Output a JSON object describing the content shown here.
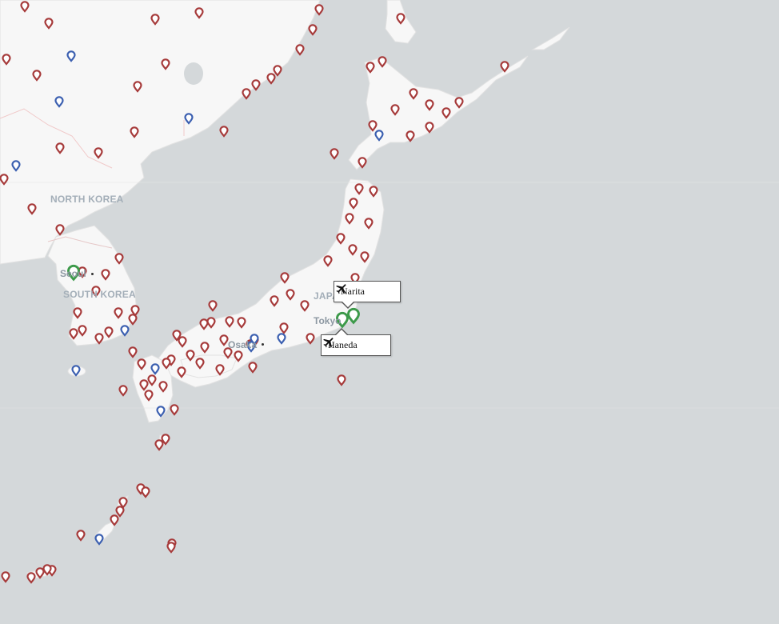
{
  "map": {
    "country_labels": [
      "NORTH KOREA",
      "SOUTH KOREA",
      "JAPAN"
    ],
    "city_labels": [
      "Seoul",
      "Osaka",
      "Tokyo"
    ],
    "airports_selected": [
      {
        "name": "Narita",
        "icon": "airplane-icon"
      },
      {
        "name": "Haneda",
        "icon": "airplane-icon"
      }
    ],
    "marker_colors": {
      "standard": "#a63a3a",
      "highlight": "#3b5fb0",
      "selected": "#3d9a4a",
      "land": "#f7f7f7",
      "water": "#d4d8da"
    }
  }
}
